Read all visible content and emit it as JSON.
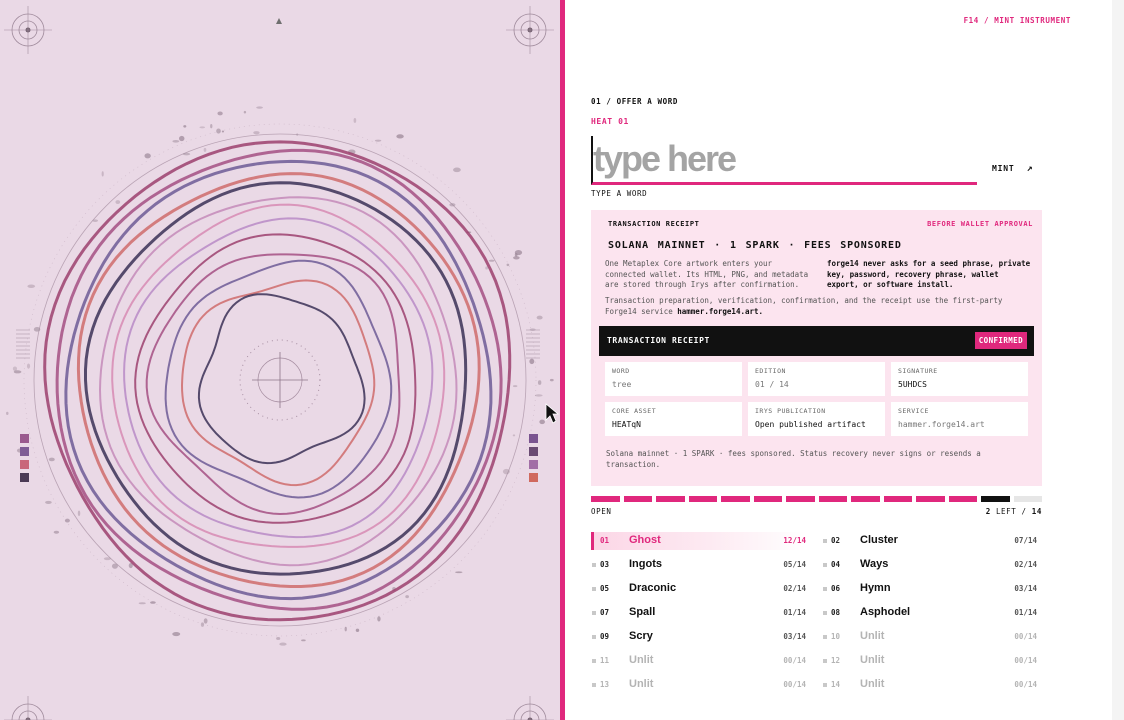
{
  "colors": {
    "accent": "#e0287d",
    "art_background": "#ead9e6",
    "dark": "#111111"
  },
  "brand": "F14 / MINT INSTRUMENT",
  "offer": {
    "step_label": "01 / OFFER A WORD",
    "heat_label": "HEAT 01",
    "input_placeholder": "type here",
    "input_value": "",
    "mint_label": "MINT",
    "mint_icon": "arrow-up-right-icon",
    "hint": "TYPE A WORD"
  },
  "receipt_card": {
    "heading": "TRANSACTION RECEIPT",
    "note": "BEFORE WALLET APPROVAL",
    "title": "SOLANA MAINNET · 1 SPARK · FEES SPONSORED",
    "description": "One Metaplex Core artwork enters your connected wallet. Its HTML, PNG, and metadata are stored through Irys after confirmation.",
    "warning": "forge14 never asks for a seed phrase, private key, password, recovery phrase, wallet export, or software install.",
    "service_text": "Transaction preparation, verification, confirmation, and the receipt use the first-party Forge14 service",
    "service_host": "hammer.forge14.art.",
    "bar_title": "TRANSACTION RECEIPT",
    "status": "CONFIRMED",
    "fields": {
      "word": {
        "label": "WORD",
        "value": "tree"
      },
      "edition": {
        "label": "EDITION",
        "value": "01 / 14"
      },
      "signature": {
        "label": "SIGNATURE",
        "value": "5UHDCS"
      },
      "core_asset": {
        "label": "CORE ASSET",
        "value": "HEATqN"
      },
      "irys": {
        "label": "IRYS PUBLICATION",
        "value": "Open published artifact"
      },
      "service": {
        "label": "SERVICE",
        "value": "hammer.forge14.art"
      }
    },
    "footer": "Solana mainnet · 1 SPARK · fees sponsored. Status recovery never signs or resends a transaction."
  },
  "progress": {
    "total_segments": 14,
    "filled_segments": 12,
    "current_segment": 13,
    "open_label": "OPEN",
    "left_count": "2",
    "left_label": "LEFT /",
    "total_label": "14"
  },
  "heats": [
    {
      "num": "01",
      "name": "Ghost",
      "count": "12/14",
      "state": "active"
    },
    {
      "num": "02",
      "name": "Cluster",
      "count": "07/14",
      "state": "open"
    },
    {
      "num": "03",
      "name": "Ingots",
      "count": "05/14",
      "state": "open"
    },
    {
      "num": "04",
      "name": "Ways",
      "count": "02/14",
      "state": "open"
    },
    {
      "num": "05",
      "name": "Draconic",
      "count": "02/14",
      "state": "open"
    },
    {
      "num": "06",
      "name": "Hymn",
      "count": "03/14",
      "state": "open"
    },
    {
      "num": "07",
      "name": "Spall",
      "count": "01/14",
      "state": "open"
    },
    {
      "num": "08",
      "name": "Asphodel",
      "count": "01/14",
      "state": "open"
    },
    {
      "num": "09",
      "name": "Scry",
      "count": "03/14",
      "state": "open"
    },
    {
      "num": "10",
      "name": "Unlit",
      "count": "00/14",
      "state": "locked"
    },
    {
      "num": "11",
      "name": "Unlit",
      "count": "00/14",
      "state": "locked"
    },
    {
      "num": "12",
      "name": "Unlit",
      "count": "00/14",
      "state": "locked"
    },
    {
      "num": "13",
      "name": "Unlit",
      "count": "00/14",
      "state": "locked"
    },
    {
      "num": "14",
      "name": "Unlit",
      "count": "00/14",
      "state": "locked"
    }
  ],
  "artwork": {
    "swatches_left": [
      "#9a5a8e",
      "#7f5d95",
      "#c9677a",
      "#4b3a55"
    ],
    "swatches_right": [
      "#7a5490",
      "#6a4b73",
      "#a26ea6",
      "#d0695e"
    ],
    "ring_colors": [
      "#9c3f6d",
      "#a44f82",
      "#6d5a95",
      "#cf6b6b",
      "#3b3056",
      "#c48ab9",
      "#d78ab3",
      "#b98ac6"
    ]
  }
}
